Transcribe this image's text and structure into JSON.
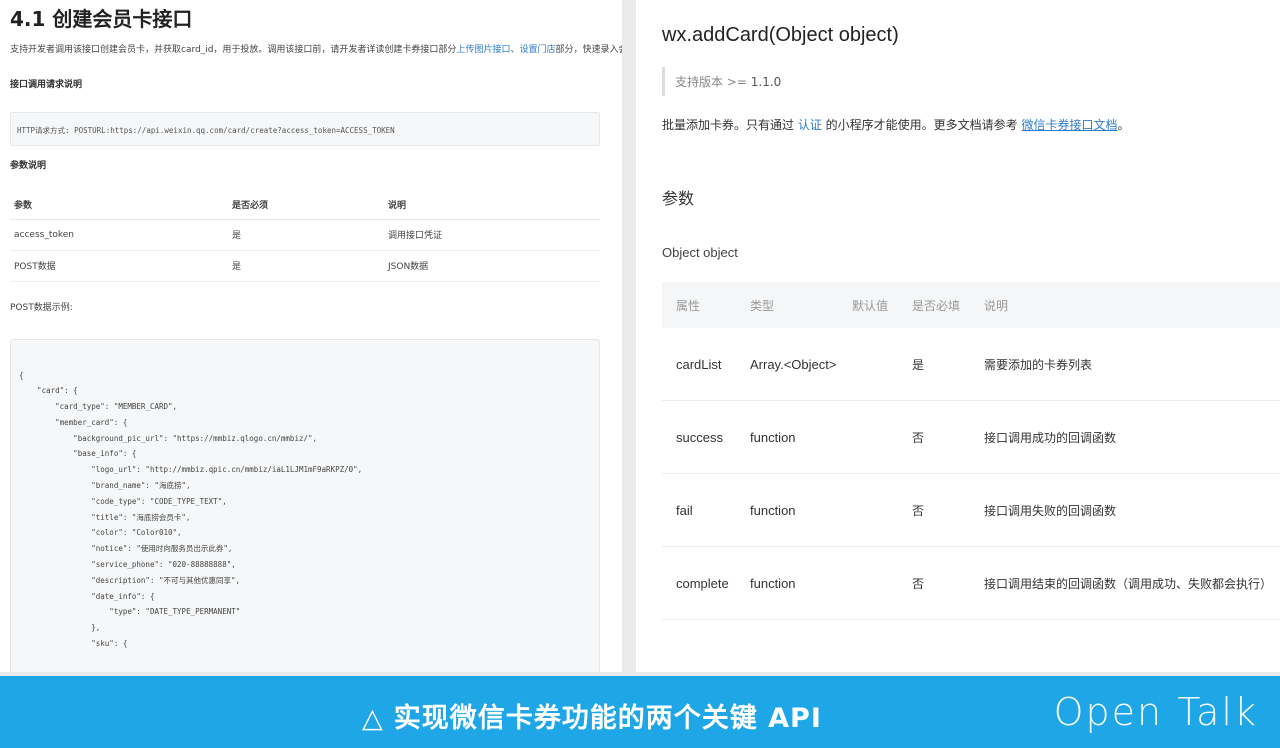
{
  "left": {
    "title": "4.1 创建会员卡接口",
    "intro_pre": "支持开发者调用该接口创建会员卡，并获取card_id，用于投放。调用该接口前，请开发者详读创建卡券接口部分",
    "intro_link1": "上传图片接口",
    "intro_sep": "、",
    "intro_link2": "设置门店",
    "intro_post": "部分，快速录入会员卡卡面必要信息。",
    "req_title": "接口调用请求说明",
    "req_text": "HTTP请求方式: POSTURL:https://api.weixin.qq.com/card/create?access_token=ACCESS_TOKEN",
    "param_title": "参数说明",
    "table": {
      "headers": [
        "参数",
        "是否必须",
        "说明"
      ],
      "rows": [
        [
          "access_token",
          "是",
          "调用接口凭证"
        ],
        [
          "POST数据",
          "是",
          "JSON数据"
        ]
      ]
    },
    "post_label": "POST数据示例:",
    "code": [
      "{",
      "    \"card\": {",
      "        \"card_type\": \"MEMBER_CARD\",",
      "        \"member_card\": {",
      "            \"background_pic_url\": \"https://mmbiz.qlogo.cn/mmbiz/\",",
      "            \"base_info\": {",
      "                \"logo_url\": \"http://mmbiz.qpic.cn/mmbiz/iaL1LJM1mF9aRKPZ/0\",",
      "                \"brand_name\": \"海底捞\",",
      "                \"code_type\": \"CODE_TYPE_TEXT\",",
      "                \"title\": \"海底捞会员卡\",",
      "                \"color\": \"Color010\",",
      "                \"notice\": \"使用时向服务员出示此券\",",
      "                \"service_phone\": \"020-88888888\",",
      "                \"description\": \"不可与其他优惠同享\",",
      "                \"date_info\": {",
      "                    \"type\": \"DATE_TYPE_PERMANENT\"",
      "                },",
      "                \"sku\": {"
    ]
  },
  "right": {
    "api_title": "wx.addCard(Object object)",
    "version_label": "支持版本 >= ",
    "version_num": "1.1.0",
    "desc_pre": "批量添加卡券。只有通过 ",
    "desc_link1": "认证",
    "desc_mid": " 的小程序才能使用。更多文档请参考 ",
    "desc_link2": "微信卡券接口文档",
    "desc_post": "。",
    "section": "参数",
    "object_label": "Object object",
    "headers": [
      "属性",
      "类型",
      "默认值",
      "是否必填",
      "说明"
    ],
    "rows": [
      {
        "name": "cardList",
        "type": "Array.<Object>",
        "default": "",
        "required": "是",
        "desc": "需要添加的卡券列表"
      },
      {
        "name": "success",
        "type": "function",
        "default": "",
        "required": "否",
        "desc": "接口调用成功的回调函数"
      },
      {
        "name": "fail",
        "type": "function",
        "default": "",
        "required": "否",
        "desc": "接口调用失败的回调函数"
      },
      {
        "name": "complete",
        "type": "function",
        "default": "",
        "required": "否",
        "desc": "接口调用结束的回调函数（调用成功、失败都会执行）"
      }
    ]
  },
  "banner": {
    "icon": "△",
    "text": "实现微信卡券功能的两个关键 API",
    "logo": "Open Talk",
    "color": "#1fa6e6"
  }
}
